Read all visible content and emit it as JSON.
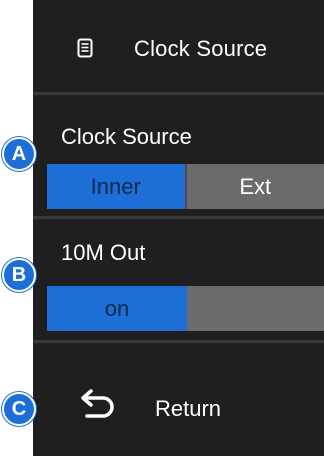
{
  "header": {
    "title": "Clock Source",
    "icon": "document-icon"
  },
  "clock_source": {
    "label": "Clock Source",
    "options": [
      "Inner",
      "Ext"
    ],
    "selected": "Inner"
  },
  "ten_m_out": {
    "label": "10M Out",
    "options": [
      "on",
      ""
    ],
    "selected": "on"
  },
  "return": {
    "label": "Return",
    "icon": "return-arrow-icon"
  },
  "markers": [
    "A",
    "B",
    "C"
  ],
  "colors": {
    "panel_bg": "#1f1f1f",
    "active": "#1e6ed8",
    "inactive": "#6b6b6b",
    "text": "#ffffff"
  }
}
